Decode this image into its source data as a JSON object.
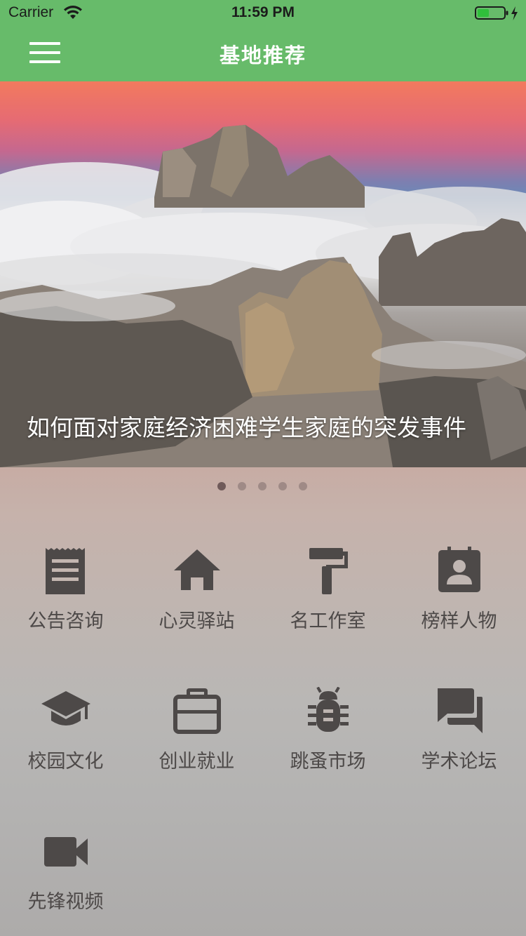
{
  "status_bar": {
    "carrier": "Carrier",
    "time": "11:59 PM"
  },
  "nav": {
    "title": "基地推荐",
    "menu_icon": "hamburger-menu-icon"
  },
  "banner": {
    "caption": "如何面对家庭经济困难学生家庭的突发事件",
    "page_count": 5,
    "active_page": 1
  },
  "grid": {
    "items": [
      {
        "label": "公告咨询",
        "icon": "notice-list-icon"
      },
      {
        "label": "心灵驿站",
        "icon": "home-icon"
      },
      {
        "label": "名工作室",
        "icon": "paint-roller-icon"
      },
      {
        "label": "榜样人物",
        "icon": "contact-card-icon"
      },
      {
        "label": "校园文化",
        "icon": "graduation-cap-icon"
      },
      {
        "label": "创业就业",
        "icon": "briefcase-icon"
      },
      {
        "label": "跳蚤市场",
        "icon": "bug-icon"
      },
      {
        "label": "学术论坛",
        "icon": "forum-icon"
      },
      {
        "label": "先锋视频",
        "icon": "video-camera-icon"
      }
    ]
  },
  "colors": {
    "nav_green": "#67bb6a",
    "icon_gray": "#4d4948"
  }
}
